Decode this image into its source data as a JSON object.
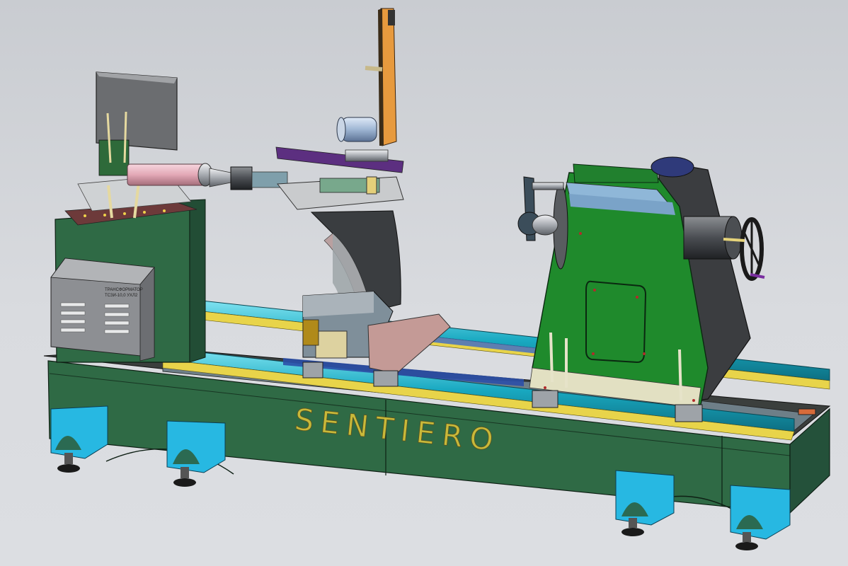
{
  "scene": {
    "brand_text": "SENTIERO",
    "transformer_label_line1": "ТРАНСФОРМАТОР",
    "transformer_label_line2": "ТСЗИ-10,0 УХЛ2"
  },
  "colors": {
    "background": "#d4d6da",
    "bed_green": "#2f6a45",
    "headstock_green": "#1f8a2c",
    "rail_cyan": "#1fb0c6",
    "rail_yellow": "#e8d44a",
    "feet_blue": "#27b8e2",
    "arm_orange": "#e79a3e",
    "roller_pink": "#e7b4c0",
    "panel_grey": "#8d8f93",
    "brand_text": "#c8b93a"
  }
}
